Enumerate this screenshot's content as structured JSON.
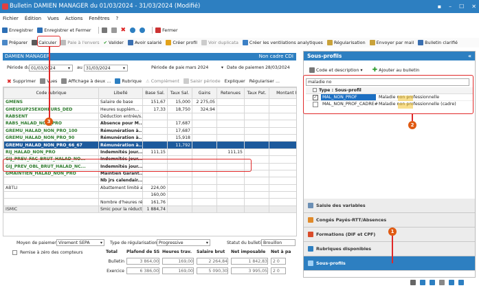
{
  "window": {
    "title": "Bulletin DAMIEN MANAGER du 01/03/2024 - 31/03/2024 (Modifié)",
    "controls": [
      "▪",
      "–",
      "☐",
      "✕"
    ]
  },
  "menu": [
    "Fichier",
    "Édition",
    "Vues",
    "Actions",
    "Fenêtres",
    "?"
  ],
  "toolbar1": {
    "save": "Enregistrer",
    "save_close": "Enregistrer et Fermer",
    "close": "Fermer"
  },
  "toolbar2": {
    "prepare": "Préparer",
    "calculer": "Calculer",
    "paie_envers": "Paie à l'envers",
    "valider": "Valider",
    "avoir": "Avoir salarié",
    "creer_profil": "Créer profil",
    "voir_dup": "Voir duplicata",
    "ventilations": "Créer les ventilations analytiques",
    "regularisation": "Régularisation",
    "envoyer_mail": "Envoyer par mail",
    "bulletin_clarifie": "Bulletin clarifié"
  },
  "panel": {
    "employee": "DAMIEN MANAGER",
    "status": "Non cadre CDI"
  },
  "period": {
    "label": "Période du",
    "from": "01/03/2024",
    "to_label": "au",
    "to": "31/03/2024",
    "pay_label": "Période de paie",
    "pay": "mars 2024",
    "date_label": "Date de paiement",
    "date": "28/03/2024"
  },
  "grid_toolbar": {
    "supprimer": "Supprimer",
    "vues": "Vues",
    "affichage": "Affichage à deux ...",
    "rubrique": "Rubrique",
    "complement": "Complément",
    "saisir_periode": "Saisir période",
    "expliquer": "Expliquer",
    "regulariser": "Régulariser ..."
  },
  "table": {
    "headers": [
      "Code rubrique",
      "Libellé",
      "Base Sal.",
      "Taux Sal.",
      "Gains",
      "Retenues",
      "Taux Pat.",
      "Montant Pa"
    ],
    "rows": [
      {
        "code": "GMENS",
        "lib": "Salaire de base",
        "base": "151,67",
        "taux": "15,000",
        "gains": "2 275,05",
        "ret": "",
        "style": "green"
      },
      {
        "code": "GHEUSUP25EXOHEURS_DED",
        "lib": "Heures supplém...",
        "base": "17,33",
        "taux": "18,750",
        "gains": "324,94",
        "ret": "",
        "style": "green"
      },
      {
        "code": "RABSENT",
        "lib": "Déduction entrée/s...",
        "base": "",
        "taux": "",
        "gains": "",
        "ret": "",
        "style": "green"
      },
      {
        "code": "RABS_HALAD_NON_PRO",
        "lib": "Absence pour M...",
        "base": "",
        "taux": "17,687",
        "gains": "",
        "ret": "",
        "style": "green"
      },
      {
        "code": "GREMU_HALAD_NON_PRO_100",
        "lib": "Rémunération à...",
        "base": "",
        "taux": "17,687",
        "gains": "",
        "ret": "",
        "style": "green"
      },
      {
        "code": "GREMU_HALAD_NON_PRO_90",
        "lib": "Rémunération à...",
        "base": "",
        "taux": "15,918",
        "gains": "",
        "ret": "",
        "style": "green"
      },
      {
        "code": "GREMU_HALAD_NON_PRO_66_67",
        "lib": "Rémunération à...",
        "base": "",
        "taux": "11,792",
        "gains": "",
        "ret": "",
        "style": "sel"
      },
      {
        "code": "RIJ_HALAD_NON_PRO",
        "lib": "Indemnités jour...",
        "base": "111,15",
        "taux": "",
        "gains": "",
        "ret": "111,15",
        "style": "green"
      },
      {
        "code": "GIJ_PREV_FAC_BRUT_HALAD_NO...",
        "lib": "Indemnités jour...",
        "base": "",
        "taux": "",
        "gains": "",
        "ret": "",
        "style": "green"
      },
      {
        "code": "GIJ_PREV_OBL_BRUT_HALAD_NC...",
        "lib": "Indemnités jour...",
        "base": "",
        "taux": "",
        "gains": "",
        "ret": "",
        "style": "green"
      },
      {
        "code": "GMAINTIEN_HALAD_NON_PRO",
        "lib": "Maintien Garant...",
        "base": "",
        "taux": "",
        "gains": "",
        "ret": "",
        "style": "green"
      },
      {
        "code": "",
        "lib": "Nb jrs calendair...",
        "base": "",
        "taux": "",
        "gains": "",
        "ret": "",
        "style": "green"
      },
      {
        "code": "ABTLI",
        "lib": "Abattement limité a...",
        "base": "224,00",
        "taux": "",
        "gains": "",
        "ret": "",
        "style": "plain"
      },
      {
        "code": "",
        "lib": "",
        "base": "160,00",
        "taux": "",
        "gains": "",
        "ret": "",
        "style": "plain"
      },
      {
        "code": "",
        "lib": "Nombre d'heures ré...",
        "base": "161,76",
        "taux": "",
        "gains": "",
        "ret": "",
        "style": "plain"
      },
      {
        "code": "ISMIC",
        "lib": "Smic pour la réducti...",
        "base": "1 884,74",
        "taux": "",
        "gains": "",
        "ret": "",
        "style": "grey"
      }
    ]
  },
  "footer": {
    "moyen_label": "Moyen de paiement",
    "moyen": "Virement SEPA",
    "regul_label": "Type de régularisation",
    "regul": "Progressive",
    "statut_label": "Statut du bulletin",
    "statut": "Brouillon",
    "remise": "Remise à zéro des compteurs",
    "totals_headers": [
      "Total",
      "Plafond de SS",
      "Heures trav.",
      "Salaire brut",
      "Net imposable",
      "Net à pa"
    ],
    "bulletin_label": "Bulletin",
    "bulletin": [
      "3 864,00",
      "169,00",
      "2 264,84",
      "1 842,83",
      "2 0"
    ],
    "exercice_label": "Exercice",
    "exercice": [
      "6 386,00",
      "169,00",
      "5 090,30",
      "3 995,05",
      "2 0"
    ]
  },
  "right_panel": {
    "title": "Sous-profils",
    "collapse": "«",
    "view_label": "Code et description",
    "add_label": "Ajouter au bulletin",
    "search_value": "maladie no",
    "group_label": "Type : Sous-profil",
    "items": [
      {
        "code": "MAL_NON_PROF",
        "desc": "Maladie non professionnelle",
        "checked": true
      },
      {
        "code": "MAL_NON_PROF_CADRE#",
        "desc": "Maladie non professionnelle (cadre)",
        "checked": false
      }
    ],
    "nav": [
      "Saisie des variables",
      "Congés Payés-RTT/Absences",
      "Formations (DIF et CPF)",
      "Rubriques disponibles",
      "Sous-profils"
    ]
  },
  "badges": {
    "one": "1",
    "two": "2",
    "three": "3"
  }
}
